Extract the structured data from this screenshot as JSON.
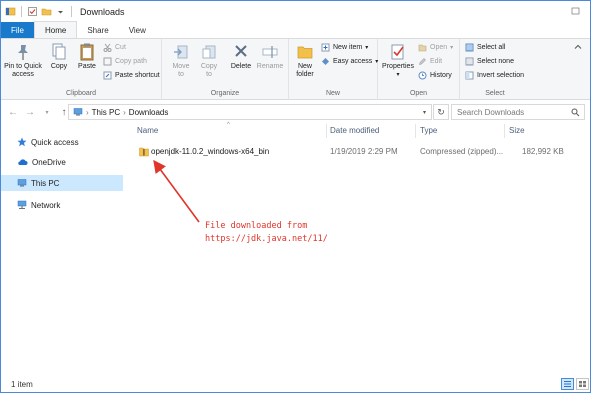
{
  "window": {
    "title": "Downloads"
  },
  "tabs": [
    {
      "label": "File"
    },
    {
      "label": "Home"
    },
    {
      "label": "Share"
    },
    {
      "label": "View"
    }
  ],
  "ribbon": {
    "clipboard": {
      "label": "Clipboard",
      "pin": "Pin to Quick access",
      "copy": "Copy",
      "paste": "Paste",
      "cut": "Cut",
      "copy_path": "Copy path",
      "paste_shortcut": "Paste shortcut"
    },
    "organize": {
      "label": "Organize",
      "move_to": "Move to",
      "copy_to": "Copy to",
      "delete": "Delete",
      "rename": "Rename"
    },
    "new": {
      "label": "New",
      "new_folder": "New folder",
      "new_item": "New item",
      "easy_access": "Easy access"
    },
    "open": {
      "label": "Open",
      "properties": "Properties",
      "open": "Open",
      "edit": "Edit",
      "history": "History"
    },
    "select": {
      "label": "Select",
      "select_all": "Select all",
      "select_none": "Select none",
      "invert_selection": "Invert selection"
    }
  },
  "address": {
    "crumbs": [
      "This PC",
      "Downloads"
    ],
    "search_placeholder": "Search Downloads"
  },
  "nav_pane": [
    {
      "label": "Quick access",
      "icon": "star-icon"
    },
    {
      "label": "OneDrive",
      "icon": "cloud-icon"
    },
    {
      "label": "This PC",
      "icon": "computer-icon",
      "selected": true
    },
    {
      "label": "Network",
      "icon": "network-icon"
    }
  ],
  "columns": {
    "name": "Name",
    "date": "Date modified",
    "type": "Type",
    "size": "Size"
  },
  "files": [
    {
      "name": "openjdk-11.0.2_windows-x64_bin",
      "date": "1/19/2019 2:29 PM",
      "type": "Compressed (zipped)...",
      "size": "182,992 KB"
    }
  ],
  "annotation": {
    "line1": "File downloaded from",
    "line2": "https://jdk.java.net/11/",
    "color": "#e0352b"
  },
  "status": {
    "count": "1 item"
  },
  "colors": {
    "accent": "#1979ca",
    "selection": "#cce8ff",
    "folder": "#f4c04c"
  }
}
